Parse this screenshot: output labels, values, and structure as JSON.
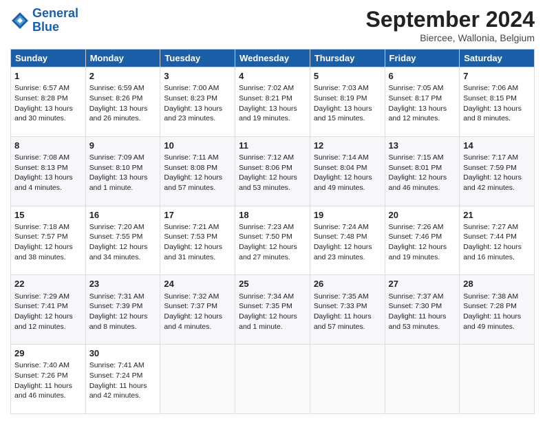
{
  "header": {
    "logo_line1": "General",
    "logo_line2": "Blue",
    "month": "September 2024",
    "location": "Biercee, Wallonia, Belgium"
  },
  "days_of_week": [
    "Sunday",
    "Monday",
    "Tuesday",
    "Wednesday",
    "Thursday",
    "Friday",
    "Saturday"
  ],
  "weeks": [
    [
      {
        "day": "1",
        "info": "Sunrise: 6:57 AM\nSunset: 8:28 PM\nDaylight: 13 hours and 30 minutes."
      },
      {
        "day": "2",
        "info": "Sunrise: 6:59 AM\nSunset: 8:26 PM\nDaylight: 13 hours and 26 minutes."
      },
      {
        "day": "3",
        "info": "Sunrise: 7:00 AM\nSunset: 8:23 PM\nDaylight: 13 hours and 23 minutes."
      },
      {
        "day": "4",
        "info": "Sunrise: 7:02 AM\nSunset: 8:21 PM\nDaylight: 13 hours and 19 minutes."
      },
      {
        "day": "5",
        "info": "Sunrise: 7:03 AM\nSunset: 8:19 PM\nDaylight: 13 hours and 15 minutes."
      },
      {
        "day": "6",
        "info": "Sunrise: 7:05 AM\nSunset: 8:17 PM\nDaylight: 13 hours and 12 minutes."
      },
      {
        "day": "7",
        "info": "Sunrise: 7:06 AM\nSunset: 8:15 PM\nDaylight: 13 hours and 8 minutes."
      }
    ],
    [
      {
        "day": "8",
        "info": "Sunrise: 7:08 AM\nSunset: 8:13 PM\nDaylight: 13 hours and 4 minutes."
      },
      {
        "day": "9",
        "info": "Sunrise: 7:09 AM\nSunset: 8:10 PM\nDaylight: 13 hours and 1 minute."
      },
      {
        "day": "10",
        "info": "Sunrise: 7:11 AM\nSunset: 8:08 PM\nDaylight: 12 hours and 57 minutes."
      },
      {
        "day": "11",
        "info": "Sunrise: 7:12 AM\nSunset: 8:06 PM\nDaylight: 12 hours and 53 minutes."
      },
      {
        "day": "12",
        "info": "Sunrise: 7:14 AM\nSunset: 8:04 PM\nDaylight: 12 hours and 49 minutes."
      },
      {
        "day": "13",
        "info": "Sunrise: 7:15 AM\nSunset: 8:01 PM\nDaylight: 12 hours and 46 minutes."
      },
      {
        "day": "14",
        "info": "Sunrise: 7:17 AM\nSunset: 7:59 PM\nDaylight: 12 hours and 42 minutes."
      }
    ],
    [
      {
        "day": "15",
        "info": "Sunrise: 7:18 AM\nSunset: 7:57 PM\nDaylight: 12 hours and 38 minutes."
      },
      {
        "day": "16",
        "info": "Sunrise: 7:20 AM\nSunset: 7:55 PM\nDaylight: 12 hours and 34 minutes."
      },
      {
        "day": "17",
        "info": "Sunrise: 7:21 AM\nSunset: 7:53 PM\nDaylight: 12 hours and 31 minutes."
      },
      {
        "day": "18",
        "info": "Sunrise: 7:23 AM\nSunset: 7:50 PM\nDaylight: 12 hours and 27 minutes."
      },
      {
        "day": "19",
        "info": "Sunrise: 7:24 AM\nSunset: 7:48 PM\nDaylight: 12 hours and 23 minutes."
      },
      {
        "day": "20",
        "info": "Sunrise: 7:26 AM\nSunset: 7:46 PM\nDaylight: 12 hours and 19 minutes."
      },
      {
        "day": "21",
        "info": "Sunrise: 7:27 AM\nSunset: 7:44 PM\nDaylight: 12 hours and 16 minutes."
      }
    ],
    [
      {
        "day": "22",
        "info": "Sunrise: 7:29 AM\nSunset: 7:41 PM\nDaylight: 12 hours and 12 minutes."
      },
      {
        "day": "23",
        "info": "Sunrise: 7:31 AM\nSunset: 7:39 PM\nDaylight: 12 hours and 8 minutes."
      },
      {
        "day": "24",
        "info": "Sunrise: 7:32 AM\nSunset: 7:37 PM\nDaylight: 12 hours and 4 minutes."
      },
      {
        "day": "25",
        "info": "Sunrise: 7:34 AM\nSunset: 7:35 PM\nDaylight: 12 hours and 1 minute."
      },
      {
        "day": "26",
        "info": "Sunrise: 7:35 AM\nSunset: 7:33 PM\nDaylight: 11 hours and 57 minutes."
      },
      {
        "day": "27",
        "info": "Sunrise: 7:37 AM\nSunset: 7:30 PM\nDaylight: 11 hours and 53 minutes."
      },
      {
        "day": "28",
        "info": "Sunrise: 7:38 AM\nSunset: 7:28 PM\nDaylight: 11 hours and 49 minutes."
      }
    ],
    [
      {
        "day": "29",
        "info": "Sunrise: 7:40 AM\nSunset: 7:26 PM\nDaylight: 11 hours and 46 minutes."
      },
      {
        "day": "30",
        "info": "Sunrise: 7:41 AM\nSunset: 7:24 PM\nDaylight: 11 hours and 42 minutes."
      },
      {
        "day": "",
        "info": ""
      },
      {
        "day": "",
        "info": ""
      },
      {
        "day": "",
        "info": ""
      },
      {
        "day": "",
        "info": ""
      },
      {
        "day": "",
        "info": ""
      }
    ]
  ]
}
